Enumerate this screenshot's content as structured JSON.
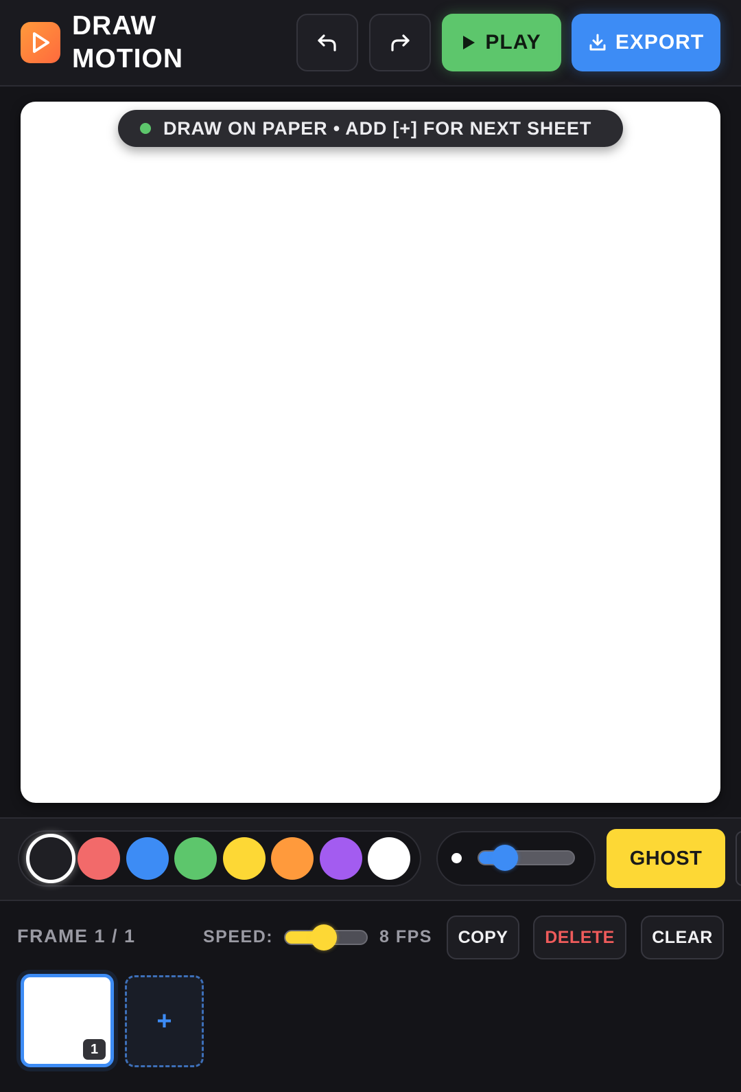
{
  "header": {
    "brand_line1": "DRAW",
    "brand_line2": "MOTION",
    "undo_icon": "undo-arrow-icon",
    "redo_icon": "redo-arrow-icon",
    "play_label": "PLAY",
    "export_label": "EXPORT",
    "colors": {
      "play": "#5dc66c",
      "export": "#3d8cf5",
      "logo": "#ff7a3d"
    }
  },
  "canvas": {
    "hint_text": "DRAW ON PAPER • ADD [+] FOR NEXT SHEET",
    "background": "#ffffff"
  },
  "toolbar": {
    "colors": [
      "#1f1f24",
      "#f26a6a",
      "#3d8cf5",
      "#5dc66c",
      "#fdd835",
      "#ff9a3c",
      "#a35cf0",
      "#ffffff"
    ],
    "selected_color_index": 0,
    "brush_size_fraction": 0.2,
    "ghost_label": "GHOST"
  },
  "timeline": {
    "frame_label": "FRAME 1 / 1",
    "speed_label": "SPEED:",
    "speed_fraction": 0.35,
    "fps_label": "8 FPS",
    "copy_label": "COPY",
    "delete_label": "DELETE",
    "clear_label": "CLEAR",
    "frames": [
      {
        "number": "1",
        "selected": true
      }
    ],
    "add_frame_label": "+"
  }
}
